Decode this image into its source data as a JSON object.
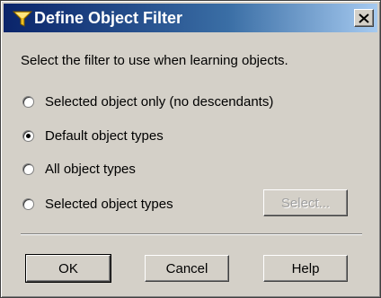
{
  "dialog": {
    "title": "Define Object Filter",
    "prompt": "Select the filter to use when learning objects."
  },
  "options": [
    {
      "label": "Selected object only (no descendants)",
      "checked": false
    },
    {
      "label": "Default object types",
      "checked": true
    },
    {
      "label": "All object types",
      "checked": false
    },
    {
      "label": "Selected object types",
      "checked": false
    }
  ],
  "select_button": {
    "label": "Select...",
    "enabled": false
  },
  "buttons": {
    "ok": "OK",
    "cancel": "Cancel",
    "help": "Help"
  },
  "colors": {
    "titlebar_start": "#0a246a",
    "titlebar_end": "#a6caf0",
    "face": "#d4d0c8"
  },
  "icons": {
    "title": "funnel-filter-icon",
    "close": "close-icon"
  }
}
